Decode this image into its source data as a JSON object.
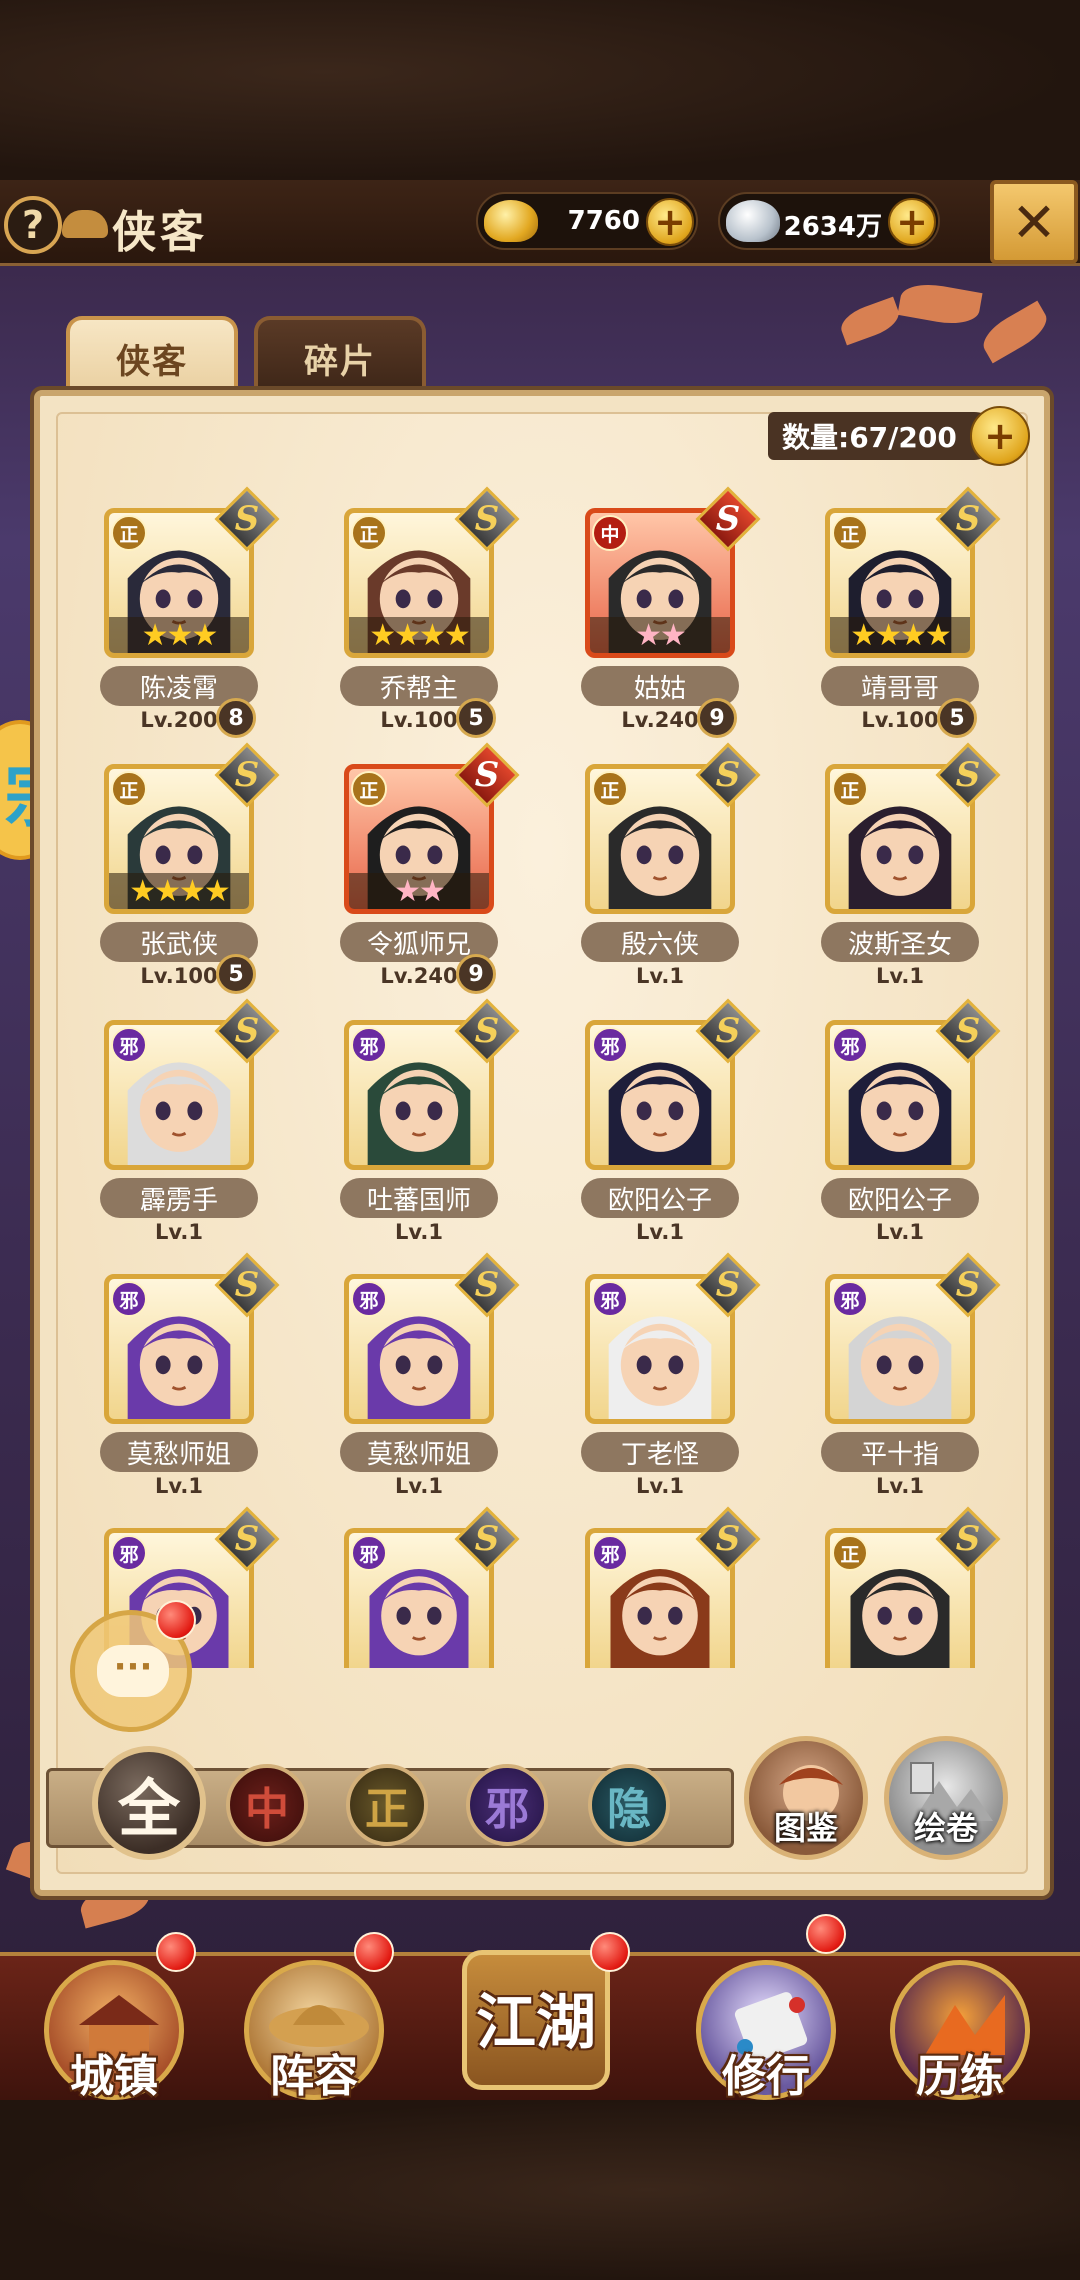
{
  "header": {
    "title": "侠客",
    "help_icon": "?",
    "gold": "7760",
    "silver": "2634万",
    "close_icon": "✕"
  },
  "side_badge": "宗",
  "tabs": [
    {
      "label": "侠客",
      "active": true
    },
    {
      "label": "碎片",
      "active": false
    }
  ],
  "count_label": "数量:67/200",
  "heroes": [
    {
      "name": "陈凌霄",
      "level": "Lv.200",
      "badge": "8",
      "align": "正",
      "stars": "★★★",
      "frame": "gold"
    },
    {
      "name": "乔帮主",
      "level": "Lv.100",
      "badge": "5",
      "align": "正",
      "stars": "★★★★",
      "frame": "gold"
    },
    {
      "name": "姑姑",
      "level": "Lv.240",
      "badge": "9",
      "align": "中",
      "stars": "★★",
      "frame": "red"
    },
    {
      "name": "靖哥哥",
      "level": "Lv.100",
      "badge": "5",
      "align": "正",
      "stars": "★★★★",
      "frame": "gold"
    },
    {
      "name": "张武侠",
      "level": "Lv.100",
      "badge": "5",
      "align": "正",
      "stars": "★★★★",
      "frame": "gold"
    },
    {
      "name": "令狐师兄",
      "level": "Lv.240",
      "badge": "9",
      "align": "正",
      "stars": "★★",
      "frame": "red"
    },
    {
      "name": "殷六侠",
      "level": "Lv.1",
      "badge": "",
      "align": "正",
      "stars": "",
      "frame": "gold"
    },
    {
      "name": "波斯圣女",
      "level": "Lv.1",
      "badge": "",
      "align": "正",
      "stars": "",
      "frame": "gold"
    },
    {
      "name": "霹雳手",
      "level": "Lv.1",
      "badge": "",
      "align": "邪",
      "stars": "",
      "frame": "gold"
    },
    {
      "name": "吐蕃国师",
      "level": "Lv.1",
      "badge": "",
      "align": "邪",
      "stars": "",
      "frame": "gold"
    },
    {
      "name": "欧阳公子",
      "level": "Lv.1",
      "badge": "",
      "align": "邪",
      "stars": "",
      "frame": "gold"
    },
    {
      "name": "欧阳公子",
      "level": "Lv.1",
      "badge": "",
      "align": "邪",
      "stars": "",
      "frame": "gold"
    },
    {
      "name": "莫愁师姐",
      "level": "Lv.1",
      "badge": "",
      "align": "邪",
      "stars": "",
      "frame": "gold"
    },
    {
      "name": "莫愁师姐",
      "level": "Lv.1",
      "badge": "",
      "align": "邪",
      "stars": "",
      "frame": "gold"
    },
    {
      "name": "丁老怪",
      "level": "Lv.1",
      "badge": "",
      "align": "邪",
      "stars": "",
      "frame": "gold"
    },
    {
      "name": "平十指",
      "level": "Lv.1",
      "badge": "",
      "align": "邪",
      "stars": "",
      "frame": "gold"
    },
    {
      "name": "",
      "level": "",
      "badge": "",
      "align": "邪",
      "stars": "",
      "frame": "gold"
    },
    {
      "name": "",
      "level": "",
      "badge": "",
      "align": "邪",
      "stars": "",
      "frame": "gold"
    },
    {
      "name": "",
      "level": "",
      "badge": "",
      "align": "邪",
      "stars": "",
      "frame": "gold"
    },
    {
      "name": "",
      "level": "",
      "badge": "",
      "align": "正",
      "stars": "",
      "frame": "gold"
    }
  ],
  "rank_letter": "S",
  "chat_icon": "···",
  "filters": [
    "全",
    "中",
    "正",
    "邪",
    "隐"
  ],
  "tujian_label": "图鉴",
  "huijuan_label": "绘卷",
  "nav": [
    "城镇",
    "阵容",
    "江湖",
    "修行",
    "历练"
  ]
}
